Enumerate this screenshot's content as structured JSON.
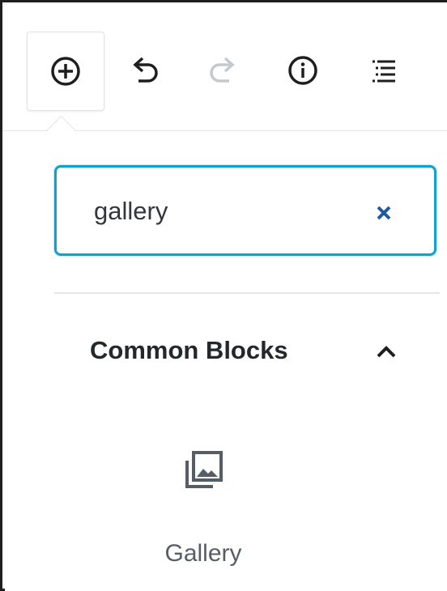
{
  "toolbar": {
    "buttons": [
      {
        "icon": "plus-circle-icon",
        "state": "active"
      },
      {
        "icon": "undo-icon",
        "state": "enabled"
      },
      {
        "icon": "redo-icon",
        "state": "disabled"
      },
      {
        "icon": "info-icon",
        "state": "enabled"
      },
      {
        "icon": "list-view-icon",
        "state": "enabled"
      }
    ]
  },
  "inserter": {
    "search": {
      "value": "gallery",
      "clear_icon": "close-icon",
      "accent_color": "#11a0d2"
    },
    "section": {
      "title": "Common Blocks",
      "toggle_icon": "chevron-up-icon"
    },
    "blocks": [
      {
        "label": "Gallery",
        "icon": "gallery-icon"
      }
    ]
  }
}
